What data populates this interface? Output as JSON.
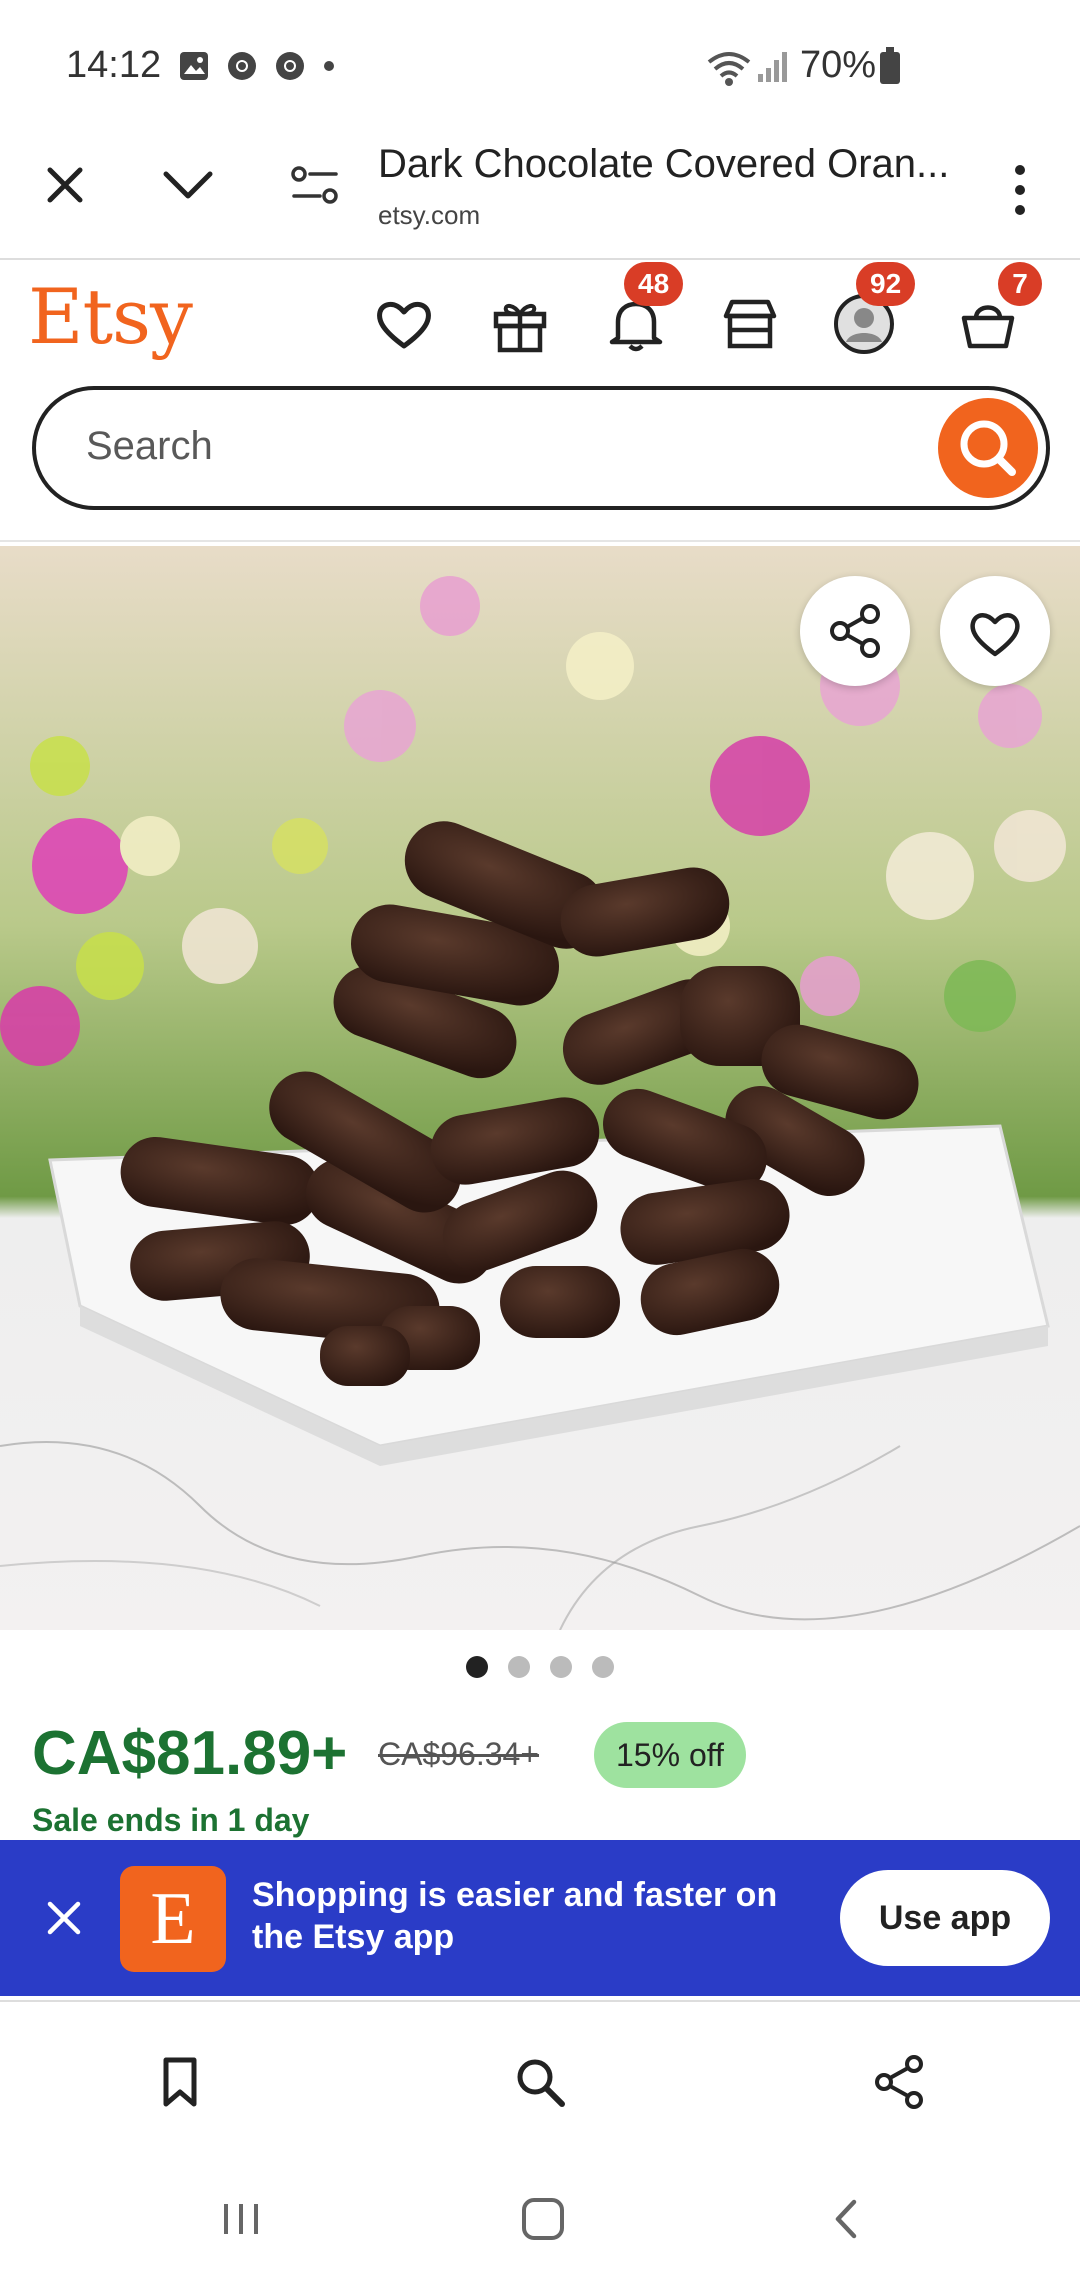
{
  "status_bar": {
    "time": "14:12",
    "battery_text": "70%",
    "icons": [
      "gallery-icon",
      "chrome-icon",
      "chrome-icon",
      "dot-icon",
      "wifi-icon",
      "signal-icon",
      "battery-icon"
    ]
  },
  "browser": {
    "title": "Dark Chocolate Covered Oran...",
    "url": "etsy.com"
  },
  "header": {
    "logo": "Etsy",
    "badges": {
      "notifications": "48",
      "account": "92",
      "cart": "7"
    },
    "search_placeholder": "Search"
  },
  "product": {
    "image_alt": "Dark chocolate covered orange peels on a white plate",
    "dots_total": 4,
    "dots_active": 1,
    "price": "CA$81.89+",
    "old_price": "CA$96.34+",
    "discount": "15% off",
    "sale_ends": "Sale ends in 1 day"
  },
  "app_banner": {
    "logo_letter": "E",
    "message": "Shopping is easier and faster on the Etsy app",
    "button": "Use app"
  },
  "colors": {
    "brand": "#F1641E",
    "price_green": "#1C7232",
    "banner_blue": "#2A3CC7",
    "badge_red": "#D93D26",
    "discount_bg": "#9EE29F"
  }
}
